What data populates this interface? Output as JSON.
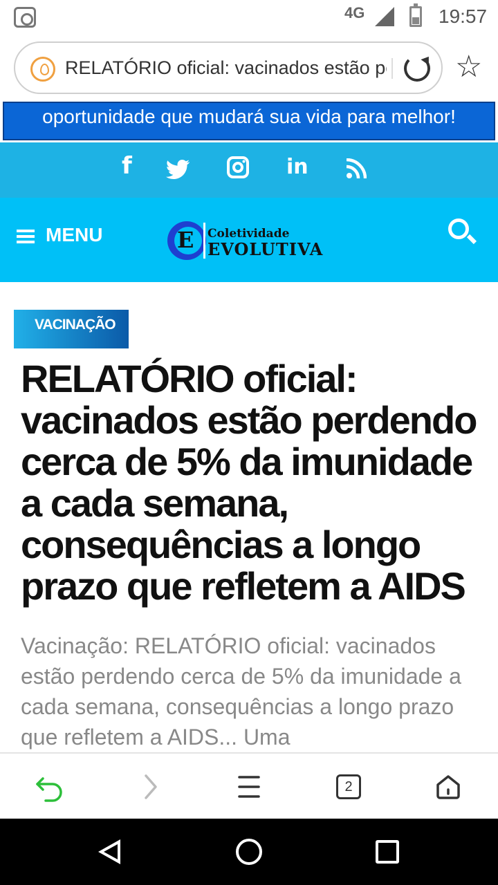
{
  "status_bar": {
    "network": "4G",
    "time": "19:57"
  },
  "address_bar": {
    "url_text": "RELATÓRIO oficial: vacinados estão perdendo"
  },
  "banner": {
    "text": "oportunidade que mudará sua vida para melhor!"
  },
  "social": {
    "icons": [
      "facebook-icon",
      "twitter-icon",
      "instagram-icon",
      "linkedin-icon",
      "rss-icon"
    ],
    "facebook": "f",
    "linkedin": "in"
  },
  "header": {
    "menu_label": "MENU",
    "logo_small": "Coletividade",
    "logo_big": "EVOLUTIVA",
    "logo_letter": "E"
  },
  "article": {
    "category": "VACINAÇÃO",
    "title": "RELATÓRIO oficial: vacinados estão perdendo cerca de 5% da imunidade a cada semana, consequências a longo prazo que refletem a AIDS",
    "excerpt": "Vacinação: RELATÓRIO oficial: vacinados estão perdendo cerca de 5% da imunidade a cada semana, consequências a longo prazo que refletem a AIDS... Uma"
  },
  "toolbar": {
    "tab_count": "2"
  },
  "colors": {
    "banner_blue": "#0b66d6",
    "social_bar": "#1eb2e4",
    "header_bar": "#00c0f7",
    "back_green": "#2dbf3a"
  }
}
